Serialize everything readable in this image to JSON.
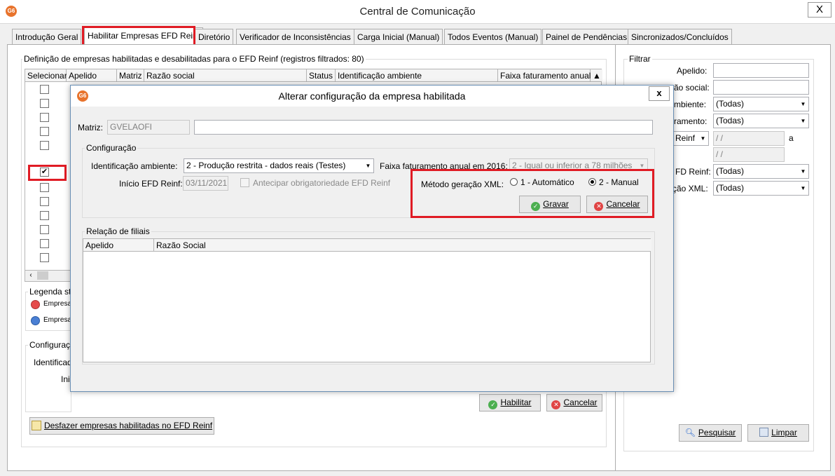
{
  "window": {
    "title": "Central de Comunicação",
    "close": "X"
  },
  "tabs": [
    {
      "label": "Introdução Geral"
    },
    {
      "label": "Habilitar Empresas EFD Reinf"
    },
    {
      "label": "Diretório"
    },
    {
      "label": "Verificador de Inconsistências"
    },
    {
      "label": "Carga Inicial (Manual)"
    },
    {
      "label": "Todos Eventos (Manual)"
    },
    {
      "label": "Painel de Pendências"
    },
    {
      "label": "Sincronizados/Concluídos"
    }
  ],
  "main": {
    "group_title": "Definição de empresas habilitadas e desabilitadas para o EFD Reinf (registros filtrados: 80)",
    "columns": [
      "Selecionar",
      "Apelido",
      "Matriz",
      "Razão social",
      "Status",
      "Identificação ambiente",
      "Faixa faturamento anual"
    ],
    "rows": [
      {
        "checked": false
      },
      {
        "checked": false
      },
      {
        "checked": false
      },
      {
        "checked": false
      },
      {
        "checked": false
      },
      {
        "checked": true
      },
      {
        "checked": false
      },
      {
        "checked": false
      },
      {
        "checked": false
      },
      {
        "checked": false
      },
      {
        "checked": false
      },
      {
        "checked": false
      }
    ],
    "legend_title": "Legenda st",
    "legend_items": [
      "Empresa",
      "Empresa"
    ],
    "config_title": "Configuraç",
    "config_ident_label": "Identificad",
    "config_ini_label": "Ini",
    "btn_habilitar": "Habilitar",
    "btn_cancelar": "Cancelar",
    "btn_desfazer": "Desfazer empresas habilitadas no EFD Reinf"
  },
  "filter": {
    "title": "Filtrar",
    "apelido_label": "Apelido:",
    "razao_label": "zão social:",
    "ambiente_label": "mbiente:",
    "faturamento_label": "ramento:",
    "reinf_select": "Reinf",
    "date1": "/ /",
    "a_label": "a",
    "date2": "/ /",
    "efd_label": "FD Reinf:",
    "xml_label": "ção XML:",
    "todos": "(Todas)",
    "btn_pesquisar": "Pesquisar",
    "btn_limpar": "Limpar"
  },
  "dialog": {
    "title": "Alterar configuração da empresa habilitada",
    "close": "x",
    "matriz_label": "Matriz:",
    "matriz_code": "GVELAOFI",
    "matriz_name": "",
    "config_title": "Configuração",
    "ident_label": "Identificação ambiente:",
    "ident_value": "2 - Produção restrita - dados reais (Testes)",
    "faixa_label": "Faixa faturamento anual em 2016:",
    "faixa_value": "2 - Igual ou inferior a 78 milhões",
    "inicio_label": "Início EFD Reinf:",
    "inicio_value": "03/11/2021",
    "antecipar_label": "Antecipar obrigatoriedade EFD Reinf",
    "metodo_label": "Método geração XML:",
    "opt_auto": "1 - Automático",
    "opt_manual": "2 - Manual",
    "btn_gravar": "Gravar",
    "btn_cancelar": "Cancelar",
    "filiais_title": "Relação de filiais",
    "filiais_columns": [
      "Apelido",
      "Razão Social"
    ]
  },
  "colors": {
    "highlight": "#e01b24",
    "logo": "#e8732c"
  }
}
